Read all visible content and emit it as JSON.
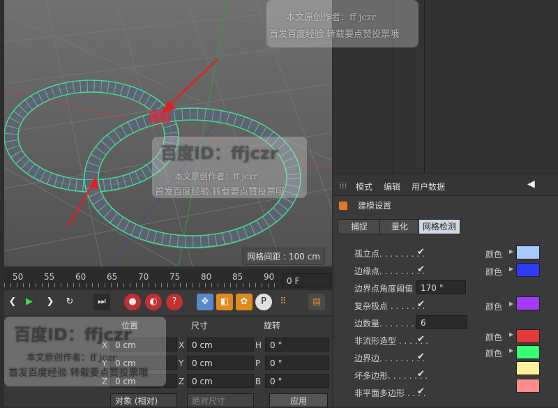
{
  "viewport": {
    "grid_spacing_label": "网格间距 : 100 cm"
  },
  "attributes": {
    "menu": [
      "模式",
      "编辑",
      "用户数据"
    ],
    "section_title": "建模设置",
    "tabs": [
      "捕捉",
      "量化",
      "网格检测"
    ],
    "active_tab": "网格检测",
    "color_label": "颜色",
    "rows": [
      {
        "label": "孤立点. . . . . . . . .",
        "checked": true,
        "color": "#a9c8ff"
      },
      {
        "label": "边缘点. . . . . . . . .",
        "checked": true,
        "color": "#2b3cff"
      },
      {
        "label": "边界点角度阈值",
        "value": "170 °"
      },
      {
        "label": "复杂极点 . . . . . . .",
        "checked": true,
        "color": "#a33bff"
      },
      {
        "label": "边数量. . . . . . . . .",
        "value": "6"
      },
      {
        "label": "非流形造型 . . . . . .",
        "checked": true,
        "color": "#e23b3b"
      },
      {
        "label": "边界边. . . . . . . . .",
        "checked": true,
        "color": "#3bff70"
      },
      {
        "label": "坏多边形. . . . . . . .",
        "checked": true,
        "color": "#fff19a"
      },
      {
        "label": "非平面多边形 . . . .",
        "checked": true,
        "color": "#ff8a8a"
      }
    ]
  },
  "timeline": {
    "ticks": [
      "50",
      "55",
      "60",
      "65",
      "70",
      "75",
      "80",
      "85",
      "90"
    ],
    "current_frame": "0 F"
  },
  "coordinates": {
    "headers": [
      "位置",
      "尺寸",
      "旋转"
    ],
    "position": [
      {
        "axis": "X",
        "value": "0 cm"
      },
      {
        "axis": "Y",
        "value": "0 cm"
      },
      {
        "axis": "Z",
        "value": "0 cm"
      }
    ],
    "size": [
      {
        "axis": "X",
        "value": "0 cm"
      },
      {
        "axis": "Y",
        "value": "0 cm"
      },
      {
        "axis": "Z",
        "value": "0 cm"
      }
    ],
    "rotation": [
      {
        "axis": "H",
        "value": "0 °"
      },
      {
        "axis": "P",
        "value": "0 °"
      },
      {
        "axis": "B",
        "value": "0 °"
      }
    ],
    "mode_select": "对象 (相对)",
    "size_select": "绝对尺寸",
    "apply_button": "应用"
  },
  "watermark": {
    "brand": "百度ID：ffjczr",
    "line1": "本文原创作者：ff jczr",
    "line2": "首发百度经验 转载要点赞投票哦"
  }
}
